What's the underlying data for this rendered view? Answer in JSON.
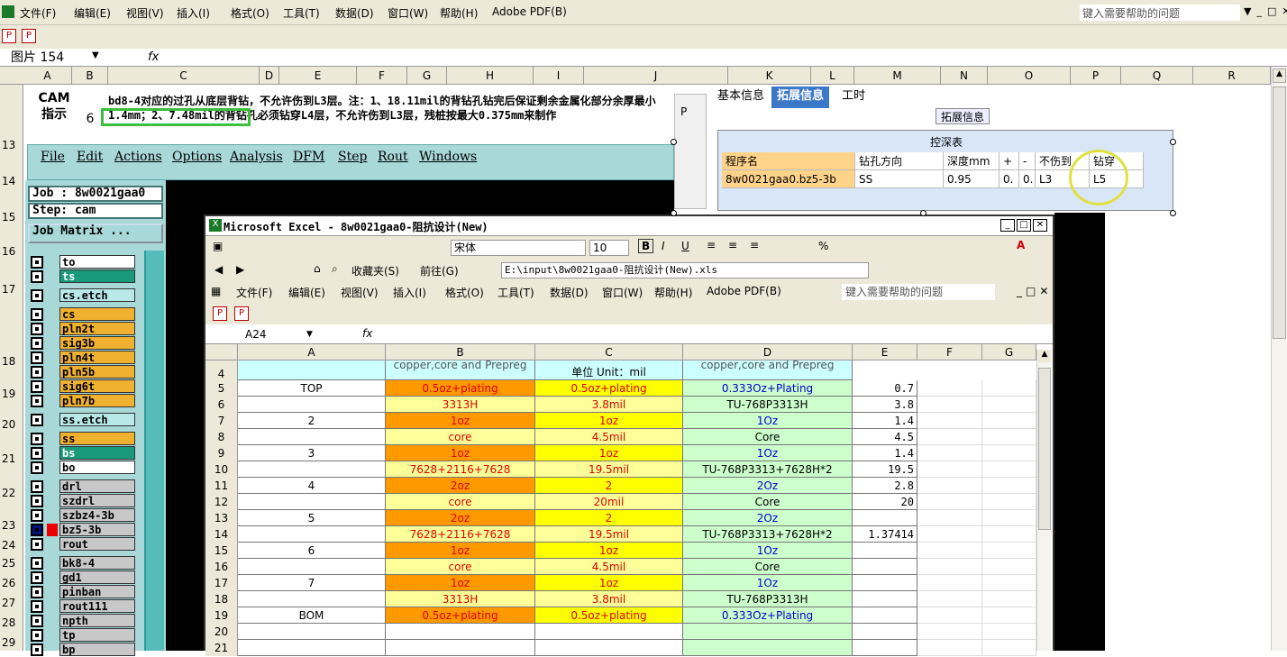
{
  "outer": {
    "menu": [
      "文件(F)",
      "编辑(E)",
      "视图(V)",
      "插入(I)",
      "格式(O)",
      "工具(T)",
      "数据(D)",
      "窗口(W)",
      "帮助(H)",
      "Adobe PDF(B)"
    ],
    "help_placeholder": "键入需要帮助的问题",
    "namebox": "图片 154",
    "fx": "fx",
    "columns": [
      "A",
      "B",
      "C",
      "D",
      "E",
      "F",
      "G",
      "H",
      "I",
      "J",
      "K",
      "L",
      "M",
      "N",
      "O",
      "P",
      "Q",
      "R"
    ],
    "rows": [
      "13",
      "14",
      "15",
      "16",
      "17",
      "18",
      "19",
      "20",
      "21",
      "22",
      "23",
      "24",
      "25",
      "26",
      "27",
      "28",
      "29"
    ],
    "cam_label": "CAM\n指示",
    "cam_num": "6",
    "note": "bd8-4对应的过孔从底层背钻，不允许伤到L3层。注：1、18.11mil的背钻孔钻完后保证剩余金属化部分余厚最小1.4mm；2、7.48mil的背钻孔必须钻穿L4层，不允许伤到L3层，残桩按最大0.375mm来制作"
  },
  "genesis": {
    "menu": [
      "File",
      "Edit",
      "Actions",
      "Options",
      "Analysis",
      "DFM",
      "Step",
      "Rout",
      "Windows"
    ],
    "job": "Job : 8w0021gaa0",
    "step": "Step: cam",
    "matrix_button": "Job Matrix ...",
    "layers": [
      {
        "name": "to",
        "color": "#ffffff"
      },
      {
        "name": "ts",
        "color": "#1a9a7a"
      },
      {
        "name": "cs.etch",
        "color": "#b8e8e8"
      },
      {
        "name": "cs",
        "color": "#f0b030"
      },
      {
        "name": "pln2t",
        "color": "#f0b030"
      },
      {
        "name": "sig3b",
        "color": "#f0b030"
      },
      {
        "name": "pln4t",
        "color": "#f0b030"
      },
      {
        "name": "pln5b",
        "color": "#f0b030"
      },
      {
        "name": "sig6t",
        "color": "#f0b030"
      },
      {
        "name": "pln7b",
        "color": "#f0b030"
      },
      {
        "name": "ss.etch",
        "color": "#b8e8e8"
      },
      {
        "name": "ss",
        "color": "#f0b030"
      },
      {
        "name": "bs",
        "color": "#1a9a7a"
      },
      {
        "name": "bo",
        "color": "#ffffff"
      },
      {
        "name": "drl",
        "color": "#c8c8c8"
      },
      {
        "name": "szdrl",
        "color": "#c8c8c8"
      },
      {
        "name": "szbz4-3b",
        "color": "#c8c8c8"
      },
      {
        "name": "bz5-3b",
        "color": "#c8c8c8"
      },
      {
        "name": "rout",
        "color": "#c8c8c8"
      },
      {
        "name": "bk8-4",
        "color": "#c8c8c8"
      },
      {
        "name": "gd1",
        "color": "#c8c8c8"
      },
      {
        "name": "pinban",
        "color": "#c8c8c8"
      },
      {
        "name": "rout111",
        "color": "#c8c8c8"
      },
      {
        "name": "npth",
        "color": "#c8c8c8"
      },
      {
        "name": "tp",
        "color": "#c8c8c8"
      },
      {
        "name": "bp",
        "color": "#c8c8c8"
      }
    ]
  },
  "ext_panel": {
    "tabs": [
      "基本信息",
      "拓展信息",
      "工时"
    ],
    "side_label": "P",
    "group_title": "拓展信息",
    "table_title": "控深表",
    "headers": [
      "程序名",
      "钻孔方向",
      "深度mm",
      "+",
      "-",
      "不伤到",
      "钻穿"
    ],
    "row": [
      "8w0021gaa0.bz5-3b",
      "SS",
      "0.95",
      "0.",
      "0.",
      "L3",
      "L5"
    ]
  },
  "inner": {
    "title": "Microsoft Excel - 8w0021gaa0-阻抗设计(New)",
    "font": "宋体",
    "size": "10",
    "favorites": "收藏夹(S)",
    "goto": "前往(G)",
    "path": "E:\\input\\8w0021gaa0-阻抗设计(New).xls",
    "menu": [
      "文件(F)",
      "编辑(E)",
      "视图(V)",
      "插入(I)",
      "格式(O)",
      "工具(T)",
      "数据(D)",
      "窗口(W)",
      "帮助(H)",
      "Adobe PDF(B)"
    ],
    "help_placeholder": "键入需要帮助的问题",
    "namebox": "A24",
    "fx": "fx",
    "columns": [
      "A",
      "B",
      "C",
      "D",
      "E",
      "F",
      "G"
    ],
    "header_row": {
      "num": "4",
      "b": "copper,core and Prepreg",
      "c": "单位 Unit：mil",
      "d": "copper,core and Prepreg"
    },
    "rows": [
      {
        "n": "5",
        "a": "TOP",
        "b": "0.5oz+plating",
        "c": "0.5oz+plating",
        "d": "0.333Oz+Plating",
        "e": "0.7",
        "t": "m"
      },
      {
        "n": "6",
        "a": "",
        "b": "3313H",
        "c": "3.8mil",
        "d": "TU-768P3313H",
        "e": "3.8",
        "t": "p"
      },
      {
        "n": "7",
        "a": "2",
        "b": "1oz",
        "c": "1oz",
        "d": "1Oz",
        "e": "1.4",
        "t": "m"
      },
      {
        "n": "8",
        "a": "",
        "b": "core",
        "c": "4.5mil",
        "d": "Core",
        "e": "4.5",
        "t": "c"
      },
      {
        "n": "9",
        "a": "3",
        "b": "1oz",
        "c": "1oz",
        "d": "1Oz",
        "e": "1.4",
        "t": "m"
      },
      {
        "n": "10",
        "a": "",
        "b": "7628+2116+7628",
        "c": "19.5mil",
        "d": "TU-768P3313+7628H*2",
        "e": "19.5",
        "t": "p"
      },
      {
        "n": "11",
        "a": "4",
        "b": "2oz",
        "c": "2",
        "d": "2Oz",
        "e": "2.8",
        "t": "m"
      },
      {
        "n": "12",
        "a": "",
        "b": "core",
        "c": "20mil",
        "d": "Core",
        "e": "20",
        "t": "c"
      },
      {
        "n": "13",
        "a": "5",
        "b": "2oz",
        "c": "2",
        "d": "2Oz",
        "e": "",
        "t": "m"
      },
      {
        "n": "14",
        "a": "",
        "b": "7628+2116+7628",
        "c": "19.5mil",
        "d": "TU-768P3313+7628H*2",
        "e": "1.37414",
        "t": "p"
      },
      {
        "n": "15",
        "a": "6",
        "b": "1oz",
        "c": "1oz",
        "d": "1Oz",
        "e": "",
        "t": "m"
      },
      {
        "n": "16",
        "a": "",
        "b": "core",
        "c": "4.5mil",
        "d": "Core",
        "e": "",
        "t": "c"
      },
      {
        "n": "17",
        "a": "7",
        "b": "1oz",
        "c": "1oz",
        "d": "1Oz",
        "e": "",
        "t": "m"
      },
      {
        "n": "18",
        "a": "",
        "b": "3313H",
        "c": "3.8mil",
        "d": "TU-768P3313H",
        "e": "",
        "t": "p"
      },
      {
        "n": "19",
        "a": "BOM",
        "b": "0.5oz+plating",
        "c": "0.5oz+plating",
        "d": "0.333Oz+Plating",
        "e": "",
        "t": "m"
      },
      {
        "n": "20",
        "a": "",
        "b": "",
        "c": "",
        "d": "",
        "e": "",
        "t": "e"
      },
      {
        "n": "21",
        "a": "",
        "b": "",
        "c": "",
        "d": "",
        "e": "",
        "t": "e"
      }
    ]
  },
  "colors": {
    "metal_orange": "#ff9900",
    "metal_yellow": "#ffff00",
    "prepreg": "#ffff99",
    "core": "#ffff99",
    "green": "#ccffcc",
    "cyan": "#ccffff",
    "tab_blue": "#3c78c8",
    "highlight_green": "#3cbf3c",
    "circle_yellow": "#e0e040"
  }
}
